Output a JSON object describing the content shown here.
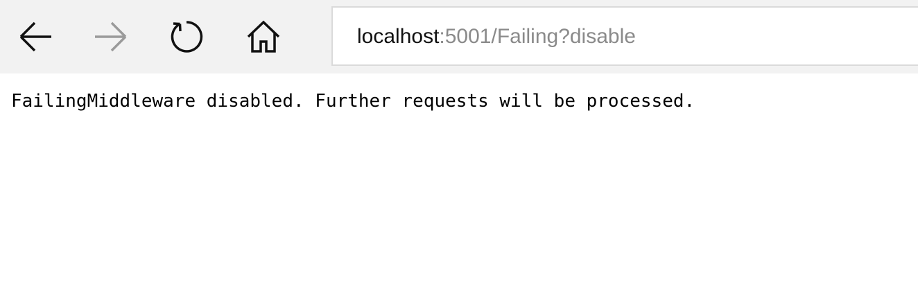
{
  "toolbar": {
    "back_icon": "arrow-left-icon",
    "forward_icon": "arrow-right-icon",
    "refresh_icon": "refresh-icon",
    "home_icon": "home-icon",
    "forward_disabled": true,
    "colors": {
      "toolbar_background": "#f2f2f2",
      "icon_active": "#111111",
      "icon_disabled": "#9a9a9a"
    }
  },
  "address_bar": {
    "host": "localhost",
    "rest": ":5001/Failing?disable",
    "colors": {
      "host": "#111111",
      "rest": "#8a8a8a"
    }
  },
  "page": {
    "body_text": "FailingMiddleware disabled. Further requests will be processed."
  }
}
